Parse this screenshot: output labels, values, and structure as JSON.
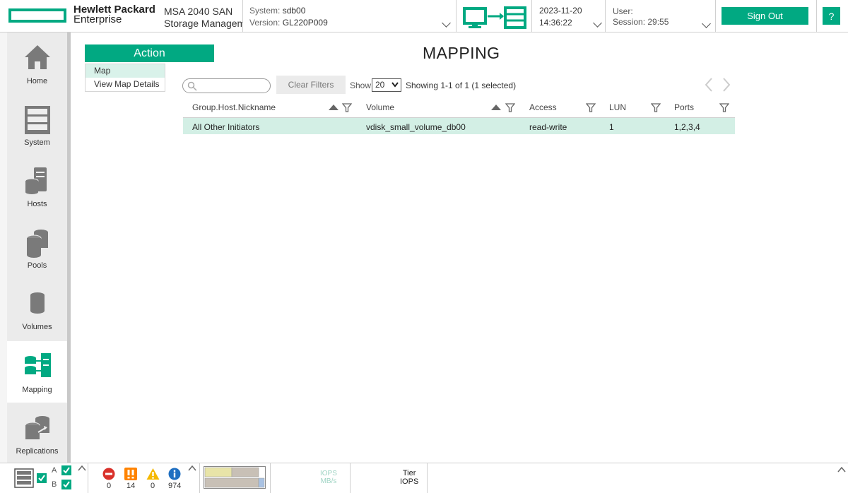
{
  "header": {
    "brand_line1": "Hewlett Packard",
    "brand_line2": "Enterprise",
    "product_line1": "MSA 2040 SAN",
    "product_line2": "Storage Management Utility",
    "system_label": "System:",
    "system_value": "sdb00",
    "version_label": "Version:",
    "version_value": "GL220P009",
    "date": "2023-11-20",
    "time": "14:36:22",
    "user_label": "User:",
    "session_label": "Session:",
    "session_value": "29:55",
    "sign_out": "Sign Out",
    "help": "?"
  },
  "sidebar": {
    "items": [
      {
        "label": "Home",
        "icon": "home-icon"
      },
      {
        "label": "System",
        "icon": "system-icon"
      },
      {
        "label": "Hosts",
        "icon": "hosts-icon"
      },
      {
        "label": "Pools",
        "icon": "pools-icon"
      },
      {
        "label": "Volumes",
        "icon": "volumes-icon"
      },
      {
        "label": "Mapping",
        "icon": "mapping-icon",
        "active": true
      },
      {
        "label": "Replications",
        "icon": "replications-icon"
      }
    ]
  },
  "action": {
    "label": "Action",
    "menu": [
      "Map",
      "View Map Details"
    ]
  },
  "page": {
    "title": "MAPPING"
  },
  "toolbar": {
    "search_placeholder": "",
    "clear_filters": "Clear Filters",
    "show_label": "Show",
    "show_value": "20",
    "showing": "Showing 1-1 of 1 (1 selected)"
  },
  "table": {
    "columns": [
      "Group.Host.Nickname",
      "Volume",
      "Access",
      "LUN",
      "Ports"
    ],
    "rows": [
      [
        "All Other Initiators",
        "vdisk_small_volume_db00",
        "read-write",
        "1",
        "1,2,3,4"
      ]
    ]
  },
  "statusbar": {
    "controller_a": "A",
    "controller_b": "B",
    "errors": "0",
    "critical": "14",
    "warnings": "0",
    "info": "974",
    "perf_iops": "IOPS",
    "perf_mbs": "MB/s",
    "tier_line1": "Tier",
    "tier_line2": "IOPS"
  },
  "colors": {
    "accent": "#01a982",
    "selected_row": "#d3efe5",
    "sidebar_bg": "#ebebeb"
  }
}
